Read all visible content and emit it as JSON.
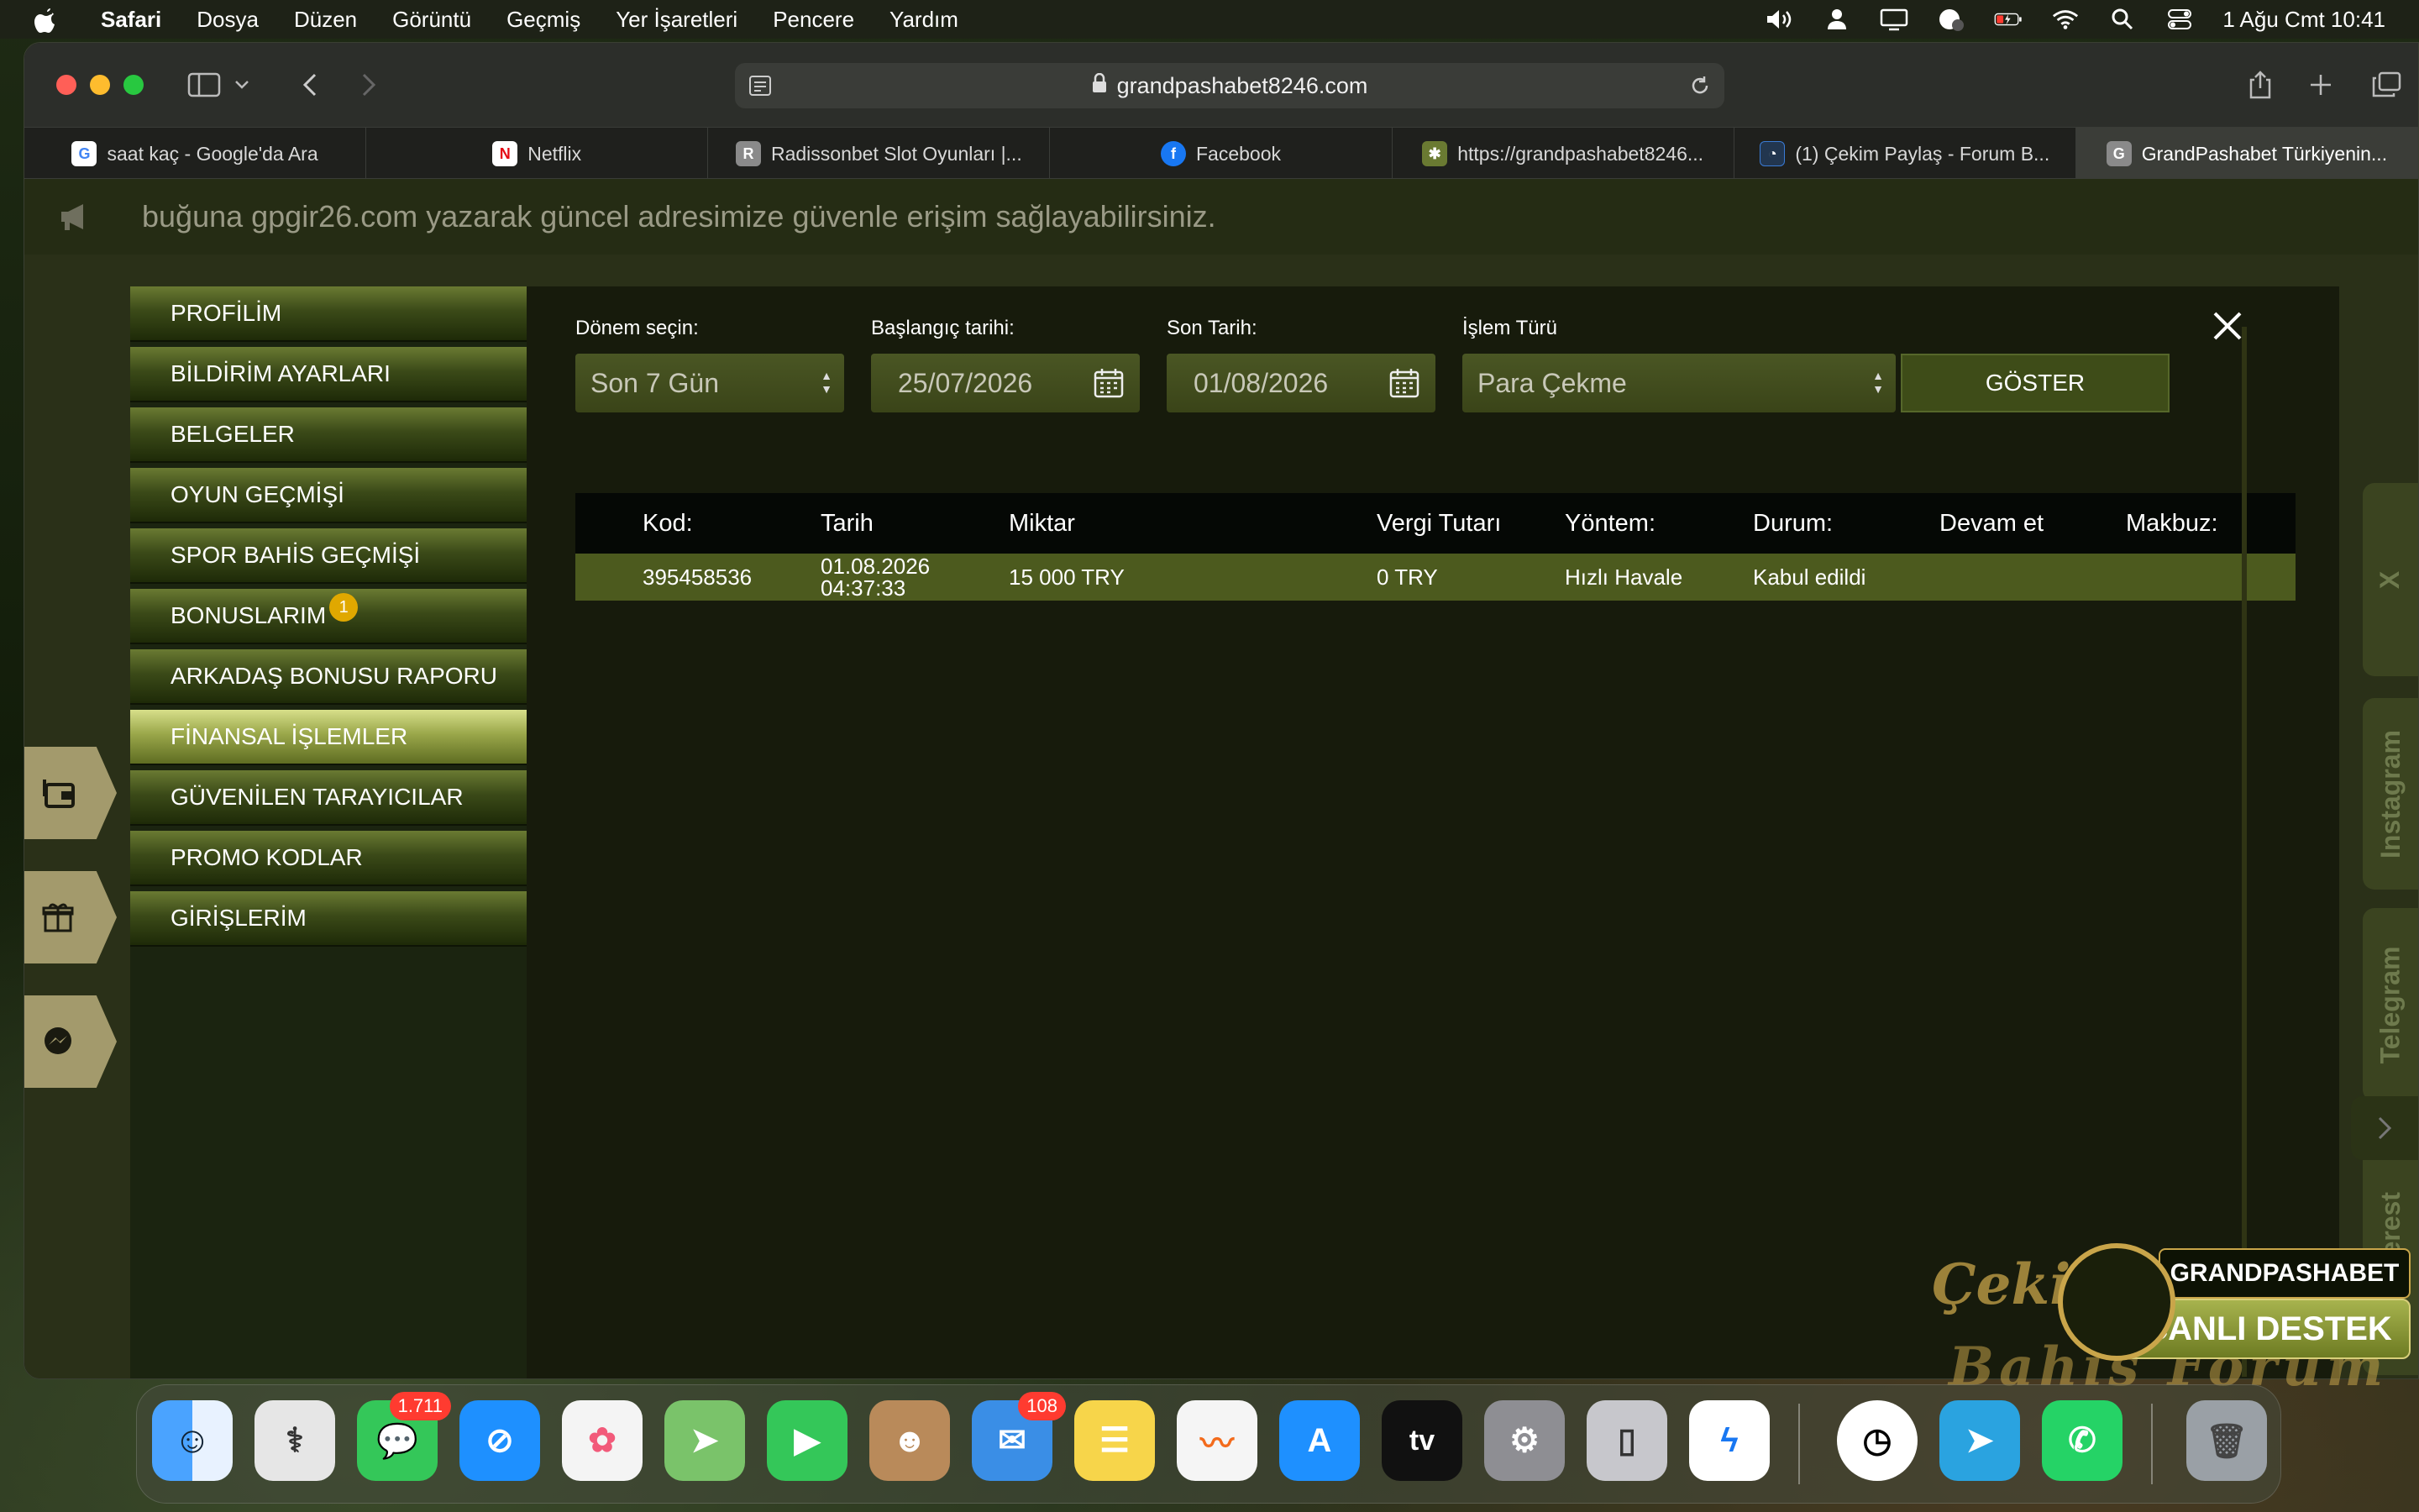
{
  "menubar": {
    "app": "Safari",
    "items": [
      "Dosya",
      "Düzen",
      "Görüntü",
      "Geçmiş",
      "Yer İşaretleri",
      "Pencere",
      "Yardım"
    ],
    "datetime": "1 Ağu Cmt  10:41"
  },
  "browser": {
    "url": "grandpashabet8246.com",
    "tabs": [
      {
        "title": "saat kaç - Google'da Ara",
        "icon": "google-icon",
        "color": "#ffffff"
      },
      {
        "title": "Netflix",
        "icon": "netflix-icon",
        "color": "#e50914"
      },
      {
        "title": "Radissonbet Slot Oyunları |...",
        "icon": "r-icon",
        "color": "#8a8a8a"
      },
      {
        "title": "Facebook",
        "icon": "facebook-icon",
        "color": "#1877f2"
      },
      {
        "title": "https://grandpashabet8246...",
        "icon": "star-icon",
        "color": "#6a7a32"
      },
      {
        "title": "(1) Çekim Paylaş - Forum B...",
        "icon": "forum-icon",
        "color": "#3a7bd5"
      },
      {
        "title": "GrandPashabet Türkiyenin...",
        "icon": "g-icon",
        "color": "#8a8a8a",
        "active": true
      }
    ]
  },
  "page": {
    "announcement": "buğuna gpgir26.com yazarak güncel adresimize güvenle erişim sağlayabilirsiniz.",
    "social": [
      "X",
      "Instagram",
      "Telegram",
      "Pinterest"
    ]
  },
  "account_menu": {
    "items": [
      {
        "label": "PROFİLİM"
      },
      {
        "label": "BİLDİRİM AYARLARI"
      },
      {
        "label": "BELGELER"
      },
      {
        "label": "OYUN GEÇMİŞİ"
      },
      {
        "label": "SPOR BAHİS GEÇMİŞİ"
      },
      {
        "label": "BONUSLARIM",
        "badge": "1"
      },
      {
        "label": "ARKADAŞ BONUSU RAPORU"
      },
      {
        "label": "FİNANSAL İŞLEMLER",
        "active": true
      },
      {
        "label": "GÜVENİLEN TARAYICILAR"
      },
      {
        "label": "PROMO KODLAR"
      },
      {
        "label": "GİRİŞLERİM"
      }
    ]
  },
  "filters": {
    "period_label": "Dönem seçin:",
    "period_value": "Son 7 Gün",
    "start_label": "Başlangıç tarihi:",
    "start_value": "25/07/2026",
    "end_label": "Son Tarih:",
    "end_value": "01/08/2026",
    "type_label": "İşlem Türü",
    "type_value": "Para Çekme",
    "show_button": "GÖSTER"
  },
  "table": {
    "headers": [
      "Kod:",
      "Tarih",
      "Miktar",
      "Vergi Tutarı",
      "Yöntem:",
      "Durum:",
      "Devam et",
      "Makbuz:"
    ],
    "rows": [
      {
        "kod": "395458536",
        "tarih_date": "01.08.2026",
        "tarih_time": "04:37:33",
        "miktar": "15 000 TRY",
        "vergi": "0 TRY",
        "yontem": "Hızlı Havale",
        "durum": "Kabul edildi",
        "devam": "",
        "makbuz": ""
      }
    ]
  },
  "overlay": {
    "watermark_line1": "Çekim Paylaş",
    "watermark_line2": "Bahis Forum",
    "support_brand": "GRANDPASHABET",
    "support_label": "CANLI DESTEK"
  },
  "dock": {
    "apps": [
      {
        "name": "Finder",
        "color": "#3a8ee6"
      },
      {
        "name": "Disk Utility",
        "color": "#d9d9d9"
      },
      {
        "name": "Messages",
        "color": "#34c759",
        "badge": "1.711"
      },
      {
        "name": "Safari",
        "color": "#1e90ff"
      },
      {
        "name": "Photos",
        "color": "#f4f4f4"
      },
      {
        "name": "Maps",
        "color": "#7ac36a"
      },
      {
        "name": "FaceTime",
        "color": "#34c759"
      },
      {
        "name": "Contacts",
        "color": "#b98a5a"
      },
      {
        "name": "Mail",
        "color": "#3a8ee6",
        "badge": "108"
      },
      {
        "name": "Notes",
        "color": "#f7d54a"
      },
      {
        "name": "Freeform",
        "color": "#f5f5f5"
      },
      {
        "name": "App Store",
        "color": "#1e90ff"
      },
      {
        "name": "TV",
        "color": "#111111",
        "label": "tv"
      },
      {
        "name": "System Settings",
        "color": "#8e8e93"
      },
      {
        "name": "iPhone Mirroring",
        "color": "#c7c7cc"
      },
      {
        "name": "Messenger",
        "color": "#ffffff"
      },
      {
        "name": "Clock",
        "color": "#ffffff"
      },
      {
        "name": "Telegram",
        "color": "#2aa3e0"
      },
      {
        "name": "WhatsApp",
        "color": "#25d366"
      },
      {
        "name": "Trash",
        "color": "#9aa0a6"
      }
    ]
  }
}
